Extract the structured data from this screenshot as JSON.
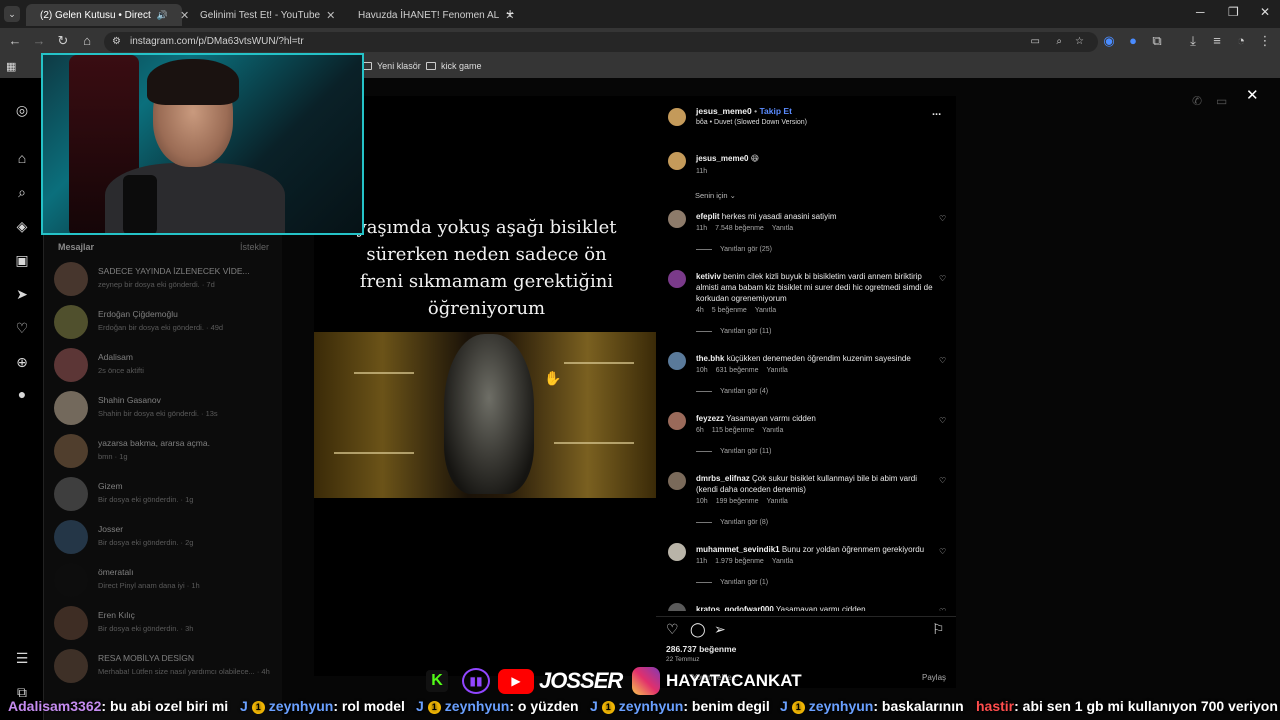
{
  "browser": {
    "tabs": [
      {
        "label": "(2) Gelen Kutusu • Direct",
        "active": true,
        "favicon_color": "#d6249f"
      },
      {
        "label": "Gelinimi Test Et! - YouTube",
        "active": false,
        "favicon_color": "#ff0000"
      },
      {
        "label": "Havuzda İHANET! Fenomen AL",
        "active": false,
        "favicon_color": "#ff0000"
      }
    ],
    "new_tab": "+",
    "url": "instagram.com/p/DMa63vtsWUN/?hl=tr",
    "bookmarks": [
      "Yeni klasör",
      "kick game"
    ]
  },
  "instagram": {
    "dm": {
      "header": "Mesajlar",
      "requests": "İstekler",
      "conversations": [
        {
          "name": "SADECE YAYINDA İZLENECEK VİDE...",
          "preview": "zeynep bir dosya eki gönderdi. · 7d",
          "avatar": "#7a5b4a"
        },
        {
          "name": "Erdoğan Çiğdemoğlu",
          "preview": "Erdoğan bir dosya eki gönderdi. · 49d",
          "avatar": "#8a8a4a"
        },
        {
          "name": "Adalisam",
          "preview": "2s önce aktifti",
          "avatar": "#a05a5a"
        },
        {
          "name": "Shahin Gasanov",
          "preview": "Shahin bir dosya eki gönderdi. · 13s",
          "avatar": "#c9b7a0"
        },
        {
          "name": "yazarsa bakma, ararsa açma.",
          "preview": "bmn · 1g",
          "avatar": "#8a6a4a"
        },
        {
          "name": "Gizem",
          "preview": "Bir dosya eki gönderdin. · 1g",
          "avatar": "#6a6a6a"
        },
        {
          "name": "Josser",
          "preview": "Bir dosya eki gönderdin. · 2g",
          "avatar": "#3a5a7a"
        },
        {
          "name": "ömeratalı",
          "preview": "Direct Pinyl anam dana iyi · 1h",
          "avatar": "#111111"
        },
        {
          "name": "Eren Kılıç",
          "preview": "Bir dosya eki gönderdin. · 3h",
          "avatar": "#6a4a3a"
        },
        {
          "name": "RESA MOBİLYA DESİGN",
          "preview": "Merhaba! Lütfen size nasıl yardımcı olabilece... · 4h",
          "avatar": "#6a5040"
        }
      ]
    },
    "reel": {
      "caption_lines": [
        "yaşımda yokuş aşağı bisiklet",
        "sürerken neden sadece ön",
        "freni sıkmamam gerektiğini",
        "öğreniyorum"
      ]
    },
    "post": {
      "author": "jesus_meme0",
      "follow": "Takip Et",
      "audio": "bôa • Duvet (Slowed Down Version)",
      "more": "...",
      "caption_user": "jesus_meme0",
      "caption_emoji": "😆",
      "caption_time": "11h",
      "sort": "Senin için",
      "comments": [
        {
          "user": "efeplit",
          "text": "herkes mi yasadi anasini satiyim",
          "time": "11h",
          "likes": "7.548 beğenme",
          "reply": "Yanıtla",
          "replies": "Yanıtları gör (25)",
          "avatar": "#8d7b6a"
        },
        {
          "user": "ketiviv",
          "text": "benim cilek kizli buyuk bi bisikletim vardi annem biriktirip almisti ama babam kiz bisiklet mi surer dedi hic ogretmedi simdi de korkudan ogrenemiyorum",
          "time": "4h",
          "likes": "5 beğenme",
          "reply": "Yanıtla",
          "replies": "Yanıtları gör (11)",
          "avatar": "#7a3a8a"
        },
        {
          "user": "the.bhk",
          "text": "küçükken denemeden öğrendim kuzenim sayesinde",
          "time": "10h",
          "likes": "631 beğenme",
          "reply": "Yanıtla",
          "replies": "Yanıtları gör (4)",
          "avatar": "#5a7a9a"
        },
        {
          "user": "feyzezz",
          "text": "Yasamayan varmı cidden",
          "time": "6h",
          "likes": "115 beğenme",
          "reply": "Yanıtla",
          "replies": "Yanıtları gör (11)",
          "avatar": "#9a6a5a"
        },
        {
          "user": "dmrbs_elifnaz",
          "text": "Çok sukur bisiklet kullanmayi bile bi abim vardi (kendi daha onceden denemis)",
          "time": "10h",
          "likes": "199 beğenme",
          "reply": "Yanıtla",
          "replies": "Yanıtları gör (8)",
          "avatar": "#7a6a5a"
        },
        {
          "user": "muhammet_sevindik1",
          "text": "Bunu zor yoldan öğrenmem gerekiyordu",
          "time": "11h",
          "likes": "1.979 beğenme",
          "reply": "Yanıtla",
          "replies": "Yanıtları gör (1)",
          "avatar": "#b9b4a8"
        },
        {
          "user": "kratos_godofwar000",
          "text": "Yasamayan varmı cidden",
          "avatar": "#5a5a5a"
        }
      ],
      "likes": "286.737 beğenme",
      "date": "22 Temmuz",
      "comment_placeholder": "Yorum ekle...",
      "share": "Paylaş"
    }
  },
  "stream_overlay": {
    "channels": [
      "JOSSER",
      "HAYATACANKAT"
    ],
    "ticker": [
      {
        "user": "Adalisam3362",
        "message": ": bu abi ozel biri mi",
        "color": "#c58cf0"
      },
      {
        "user": "zeynhyun",
        "message": ": rol model",
        "color": "#6aa0ff"
      },
      {
        "user": "zeynhyun",
        "message": ": o yüzden",
        "color": "#6aa0ff"
      },
      {
        "user": "zeynhyun",
        "message": ": benim degil",
        "color": "#6aa0ff"
      },
      {
        "user": "zeynhyun",
        "message": ": baskalarının",
        "color": "#6aa0ff"
      },
      {
        "user": "hastir",
        "message": ": abi sen 1 gb mi kullanıyon 700 veriyon",
        "color": "#ff4d4d"
      }
    ]
  }
}
